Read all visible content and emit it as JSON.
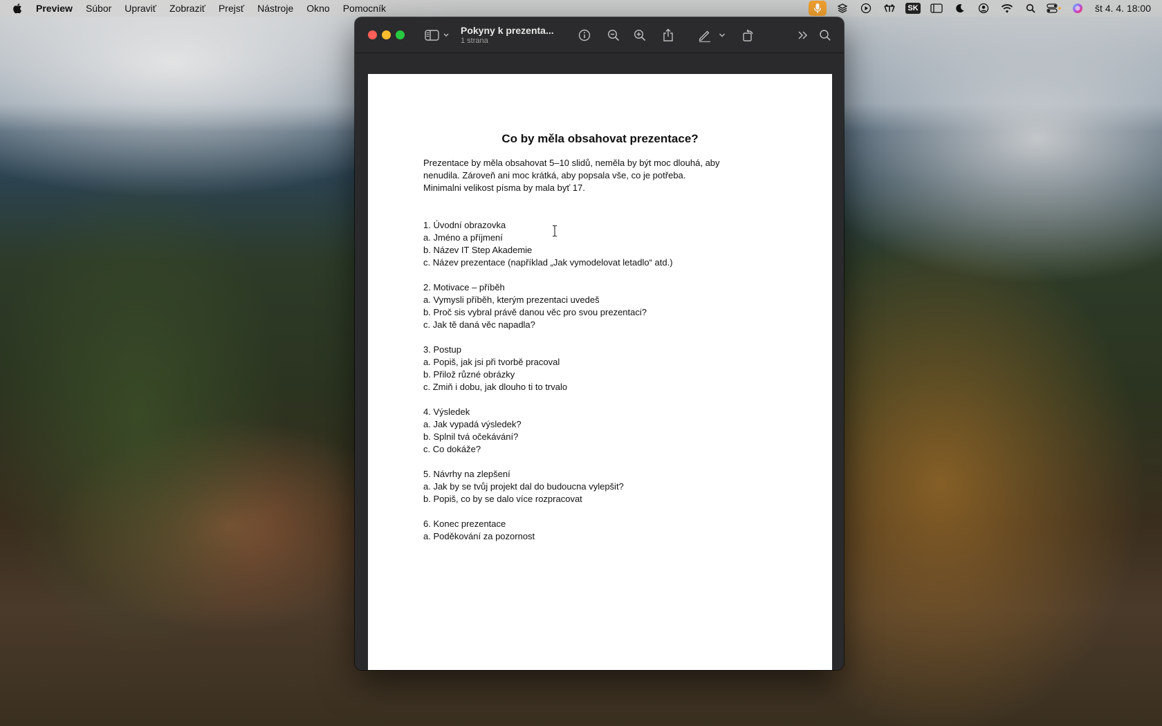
{
  "menubar": {
    "app_name": "Preview",
    "items": [
      "Súbor",
      "Upraviť",
      "Zobraziť",
      "Prejsť",
      "Nástroje",
      "Okno",
      "Pomocník"
    ],
    "input_source": "SK",
    "clock": "št 4. 4.  18:00"
  },
  "window": {
    "title": "Pokyny k prezenta...",
    "subtitle": "1 strana"
  },
  "document": {
    "title": "Co by měla obsahovat prezentace?",
    "intro": [
      "Prezentace by měla obsahovat 5–10 slidů, neměla by být moc dlouhá, aby",
      "nenudila. Zároveň ani moc krátká, aby popsala vše, co je potřeba.",
      "Minimalni velikost písma by mala byť 17."
    ],
    "sections": [
      {
        "heading": "1. Úvodní obrazovka",
        "items": [
          "a. Jméno a příjmení",
          "b. Název IT Step Akademie",
          "c. Název prezentace (například „Jak vymodelovat letadlo“ atd.)"
        ]
      },
      {
        "heading": "2. Motivace – příběh",
        "items": [
          "a. Vymysli příběh, kterým prezentaci uvedeš",
          "b. Proč sis vybral právě danou věc pro svou prezentaci?",
          "c. Jak tě daná věc napadla?"
        ]
      },
      {
        "heading": "3. Postup",
        "items": [
          "a. Popiš, jak jsi při tvorbě pracoval",
          "b. Přilož různé obrázky",
          "c. Zmiň i dobu, jak dlouho ti to trvalo"
        ]
      },
      {
        "heading": "4. Výsledek",
        "items": [
          "a. Jak vypadá výsledek?",
          "b. Splnil tvá očekávání?",
          "c. Co dokáže?"
        ]
      },
      {
        "heading": "5. Návrhy na zlepšení",
        "items": [
          "a. Jak by se tvůj projekt dal do budoucna vylepšit?",
          "b. Popiš, co by se dalo více rozpracovat"
        ]
      },
      {
        "heading": "6. Konec prezentace",
        "items": [
          "a. Poděkování za pozornost"
        ]
      }
    ]
  }
}
